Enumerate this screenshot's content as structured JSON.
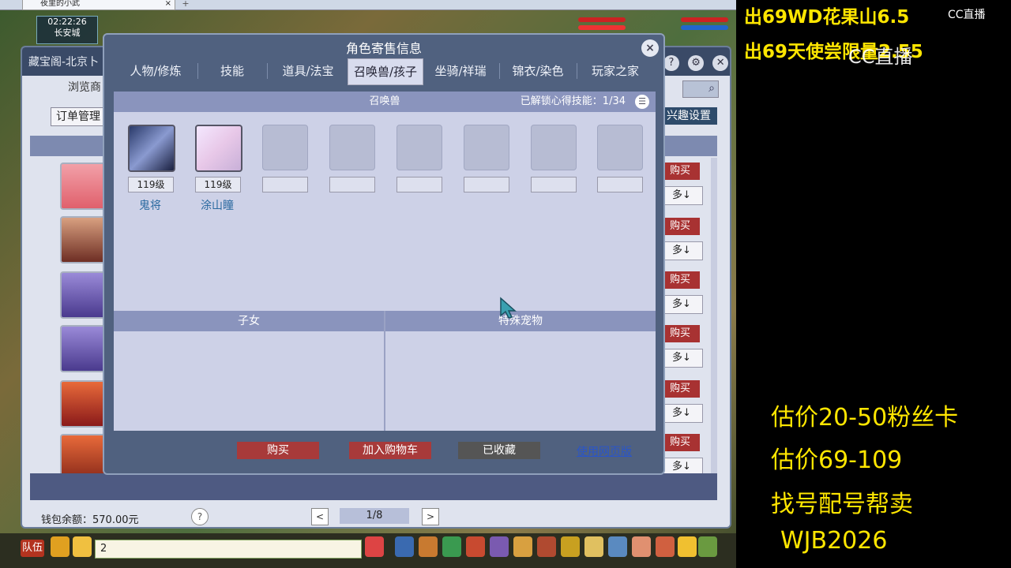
{
  "browser": {
    "tab_title": "夜里的小武",
    "close_glyph": "×",
    "new_tab_glyph": "+"
  },
  "hud": {
    "time": "02:22:26",
    "location": "长安城"
  },
  "back_window": {
    "title": "藏宝阁-北京卜",
    "browse": "浏览商",
    "order_mgmt": "订单管理",
    "interest_settings": "兴趣设置",
    "row_buttons": [
      "购买",
      "购买",
      "购买",
      "购买",
      "购买",
      "购买"
    ],
    "row_more": [
      "多↓",
      "多↓",
      "多↓",
      "多↓",
      "多↓",
      "多↓"
    ],
    "wallet": "钱包余额：570.00元",
    "help": "?",
    "page": "1/8",
    "prev": "<",
    "next": ">"
  },
  "dialog": {
    "title": "角色寄售信息",
    "close": "×",
    "tabs": [
      "人物/修炼",
      "技能",
      "道具/法宝",
      "召唤兽/孩子",
      "坐骑/祥瑞",
      "锦衣/染色",
      "玩家之家"
    ],
    "active_tab": "召唤兽/孩子",
    "summon_header": "召唤兽",
    "unlock_label": "已解锁心得技能：",
    "unlock_value": "1/34",
    "pets": [
      {
        "level": "119级",
        "name": "鬼将"
      },
      {
        "level": "119级",
        "name": "涂山瞳"
      }
    ],
    "children_header": "子女",
    "special_header": "特殊宠物",
    "buy": "购买",
    "add_cart": "加入购物车",
    "favorited": "已收藏",
    "web_link": "使用网页版"
  },
  "bottom_bar": {
    "team": "队伍",
    "chat_value": "2"
  },
  "overlay": {
    "line1": "出69WD花果山6.5",
    "line2": "出69天使尝限量2.55",
    "cc_logo": "CC直播",
    "est1": "估价20-50粉丝卡",
    "est2": "估价69-109",
    "service": "找号配号帮卖",
    "contact": "WJB2026"
  },
  "colors": {
    "overlay_text": "#ffe600",
    "buy_button": "#a83a3a",
    "dialog_frame": "#50617f",
    "link": "#2a55c8"
  }
}
